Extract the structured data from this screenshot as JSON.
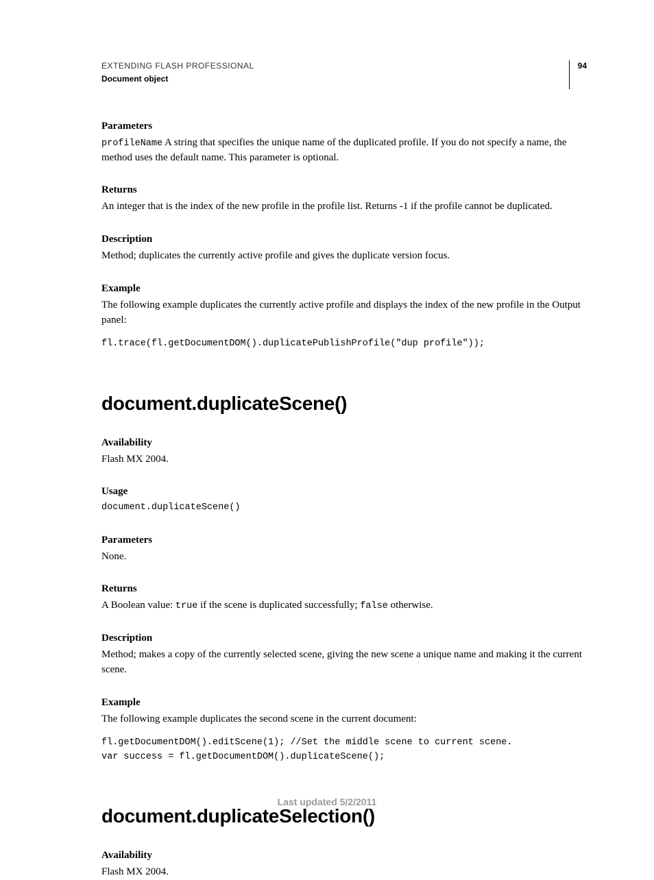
{
  "header": {
    "doc_title": "EXTENDING FLASH PROFESSIONAL",
    "doc_subtitle": "Document object",
    "page_number": "94"
  },
  "section_prev": {
    "parameters_label": "Parameters",
    "param_name": "profileName",
    "param_desc": "  A string that specifies the unique name of the duplicated profile. If you do not specify a name, the method uses the default name. This parameter is optional.",
    "returns_label": "Returns",
    "returns_text": "An integer that is the index of the new profile in the profile list. Returns -1 if the profile cannot be duplicated.",
    "description_label": "Description",
    "description_text": "Method; duplicates the currently active profile and gives the duplicate version focus.",
    "example_label": "Example",
    "example_text": "The following example duplicates the currently active profile and displays the index of the new profile in the Output panel:",
    "example_code": "fl.trace(fl.getDocumentDOM().duplicatePublishProfile(\"dup profile\"));"
  },
  "section_dupscene": {
    "title": "document.duplicateScene()",
    "availability_label": "Availability",
    "availability_text": "Flash MX 2004.",
    "usage_label": "Usage",
    "usage_code": "document.duplicateScene()",
    "parameters_label": "Parameters",
    "parameters_text": "None.",
    "returns_label": "Returns",
    "returns_pre": "A Boolean value: ",
    "returns_true": "true",
    "returns_mid": " if the scene is duplicated successfully; ",
    "returns_false": "false",
    "returns_post": " otherwise.",
    "description_label": "Description",
    "description_text": "Method; makes a copy of the currently selected scene, giving the new scene a unique name and making it the current scene.",
    "example_label": "Example",
    "example_text": "The following example duplicates the second scene in the current document:",
    "example_code": "fl.getDocumentDOM().editScene(1); //Set the middle scene to current scene. \nvar success = fl.getDocumentDOM().duplicateScene();"
  },
  "section_dupsel": {
    "title": "document.duplicateSelection()",
    "availability_label": "Availability",
    "availability_text": "Flash MX 2004."
  },
  "footer": {
    "text": "Last updated 5/2/2011"
  }
}
